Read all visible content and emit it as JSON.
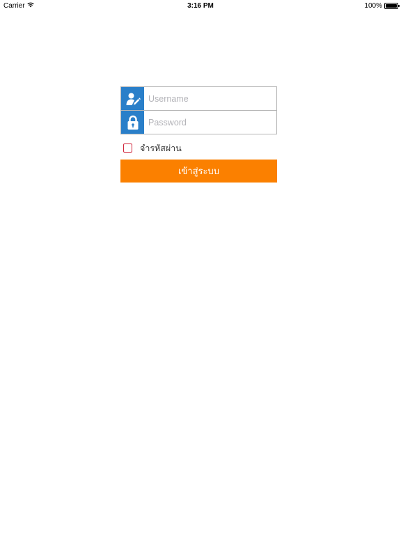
{
  "status_bar": {
    "carrier": "Carrier",
    "time": "3:16 PM",
    "battery": "100%",
    "battery_level": 1.0
  },
  "login": {
    "username": {
      "value": "",
      "placeholder": "Username",
      "icon": "user-edit-icon"
    },
    "password": {
      "value": "",
      "placeholder": "Password",
      "icon": "lock-icon"
    },
    "remember_label": "จำรหัสผ่าน",
    "remember_checked": false,
    "submit_label": "เข้าสู่ระบบ"
  },
  "colors": {
    "icon_bg": "#2a7fc9",
    "button_bg": "#fb8000",
    "checkbox_border": "#d0243a"
  }
}
